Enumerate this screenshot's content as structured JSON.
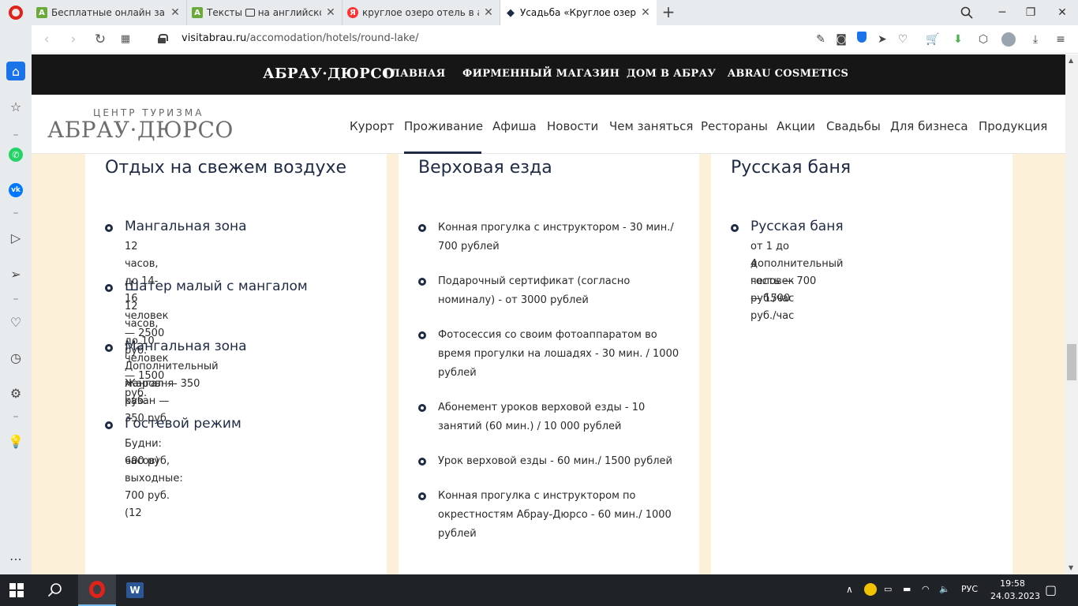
{
  "browser": {
    "tabs": [
      {
        "title": "Бесплатные онлайн заняти"
      },
      {
        "title": "Тексты"
      },
      {
        "title": "на английском"
      },
      {
        "title": "круглое озеро отель в аб"
      },
      {
        "title": "Усадьба «Круглое озеро»"
      }
    ],
    "new_tab": "+",
    "url_host": "visitabrau.ru",
    "url_path": "/accomodation/hotels/round-lake/"
  },
  "site": {
    "top_brand": "АБРАУ·ДЮРСО",
    "top_nav": [
      "ГЛАВНАЯ",
      "ФИРМЕННЫЙ МАГАЗИН",
      "ДОМ В АБРАУ",
      "ABRAU COSMETICS"
    ],
    "logo_sub": "ЦЕНТР ТУРИЗМА",
    "logo_main": "АБРАУ·ДЮРСО",
    "main_nav": [
      "Курорт",
      "Проживание",
      "Афиша",
      "Новости",
      "Чем заняться",
      "Рестораны",
      "Акции",
      "Свадьбы",
      "Для бизнеса",
      "Продукция"
    ],
    "active_nav": "Проживание"
  },
  "cards": {
    "outdoor": {
      "title": "Отдых на свежем воздухе",
      "items": [
        {
          "title": "Мангальная зона",
          "text": [
            "12 часов, до 14-16 человек — 2500 руб."
          ]
        },
        {
          "title": "Шатер малый с мангалом",
          "text": [
            "12 часов, до 10 человек — 1500 руб."
          ]
        },
        {
          "title": "Мангальная зона",
          "text": [
            "Дополнительный мангал — 350 руб.",
            "Жаровня-казан — 350 руб."
          ]
        },
        {
          "title": "Гостевой режим",
          "text": [
            "Будни: 600 руб, выходные: 700 руб. (12",
            "часов)"
          ]
        }
      ]
    },
    "riding": {
      "title": "Верховая езда",
      "items": [
        [
          "Конная прогулка с инструктором - 30 мин./",
          "700 рублей"
        ],
        [
          "Подарочный сертификат (согласно",
          "номиналу) - от 3000 рублей"
        ],
        [
          "Фотосессия со своим фотоаппаратом во",
          "время прогулки на лошадях - 30 мин. / 1000",
          "рублей"
        ],
        [
          "Абонемент уроков верховой езды - 10",
          "занятий (60 мин.) / 10 000 рублей"
        ],
        [
          "Урок верховой езды - 60 мин./ 1500 рублей"
        ],
        [
          "Конная прогулка с инструктором по",
          "окрестностям Абрау-Дюрсо - 60 мин./ 1000",
          "рублей"
        ]
      ]
    },
    "banya": {
      "title": "Русская баня",
      "items": [
        {
          "title": "Русская баня",
          "text": [
            "от 1 до 4 человек — 1500 руб./час",
            "дополнительный гость — 700 руб./час"
          ]
        }
      ]
    }
  },
  "taskbar": {
    "lang": "РУС",
    "time": "19:58",
    "date": "24.03.2023"
  },
  "colors": {
    "accent": "#1f2a44",
    "page_bg": "#fdf0d8",
    "topnav_bg": "#161616",
    "opera_red": "#e0221b"
  }
}
